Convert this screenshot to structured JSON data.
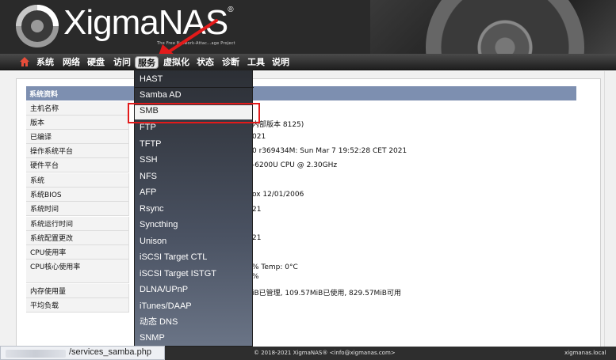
{
  "header": {
    "logo_text": "XigmaNAS",
    "logo_reg": "®",
    "tagline": "The Free Network-Attac...age Project"
  },
  "nav": {
    "home_icon": "home-icon",
    "items": [
      "系统",
      "网络",
      "硬盘",
      "访问",
      "服务",
      "虚拟化",
      "状态",
      "诊断",
      "工具",
      "说明"
    ],
    "active": "服务"
  },
  "panel": {
    "title": "系统资料",
    "rows": [
      {
        "label": "主机名称",
        "value": ""
      },
      {
        "label": "版本",
        "value": "内部版本 8125)"
      },
      {
        "label": "已编译",
        "value": "021"
      },
      {
        "label": "操作系统平台",
        "value": "0 r369434M: Sun Mar 7 19:52:28 CET 2021"
      },
      {
        "label": "硬件平台",
        "value": "-6200U CPU @ 2.30GHz"
      },
      {
        "label": "系统",
        "value": ""
      },
      {
        "label": "系统BIOS",
        "value": "ox 12/01/2006"
      },
      {
        "label": "系统时间",
        "value": "21"
      },
      {
        "label": "系统运行时间",
        "value": ""
      },
      {
        "label": "系统配置更改",
        "value": "21"
      },
      {
        "label": "CPU使用率",
        "value": ""
      },
      {
        "label": "CPU核心使用率",
        "value": "%    Temp: 0°C"
      },
      {
        "label": "",
        "value": "%"
      },
      {
        "label": "内存使用量",
        "value": "iB已管理, 109.57MiB已使用,  829.57MiB可用"
      },
      {
        "label": "平均负载",
        "value": ""
      }
    ]
  },
  "dropdown": {
    "items": [
      "HAST",
      "Samba AD",
      "SMB",
      "FTP",
      "TFTP",
      "SSH",
      "NFS",
      "AFP",
      "Rsync",
      "Syncthing",
      "Unison",
      "iSCSI Target CTL",
      "iSCSI Target ISTGT",
      "DLNA/UPnP",
      "iTunes/DAAP",
      "动态 DNS",
      "SNMP"
    ],
    "highlighted": "SMB"
  },
  "footer": {
    "url_tip": "/services_samba.php",
    "copyright": "© 2018-2021 XigmaNAS® <info@xigmanas.com>",
    "hostname": "xigmanas.local"
  },
  "colors": {
    "header_bg": "#2a2a2a",
    "panel_head": "#7d8fb0",
    "highlight_box": "#e21a1a",
    "arrow": "#e21a1a"
  }
}
